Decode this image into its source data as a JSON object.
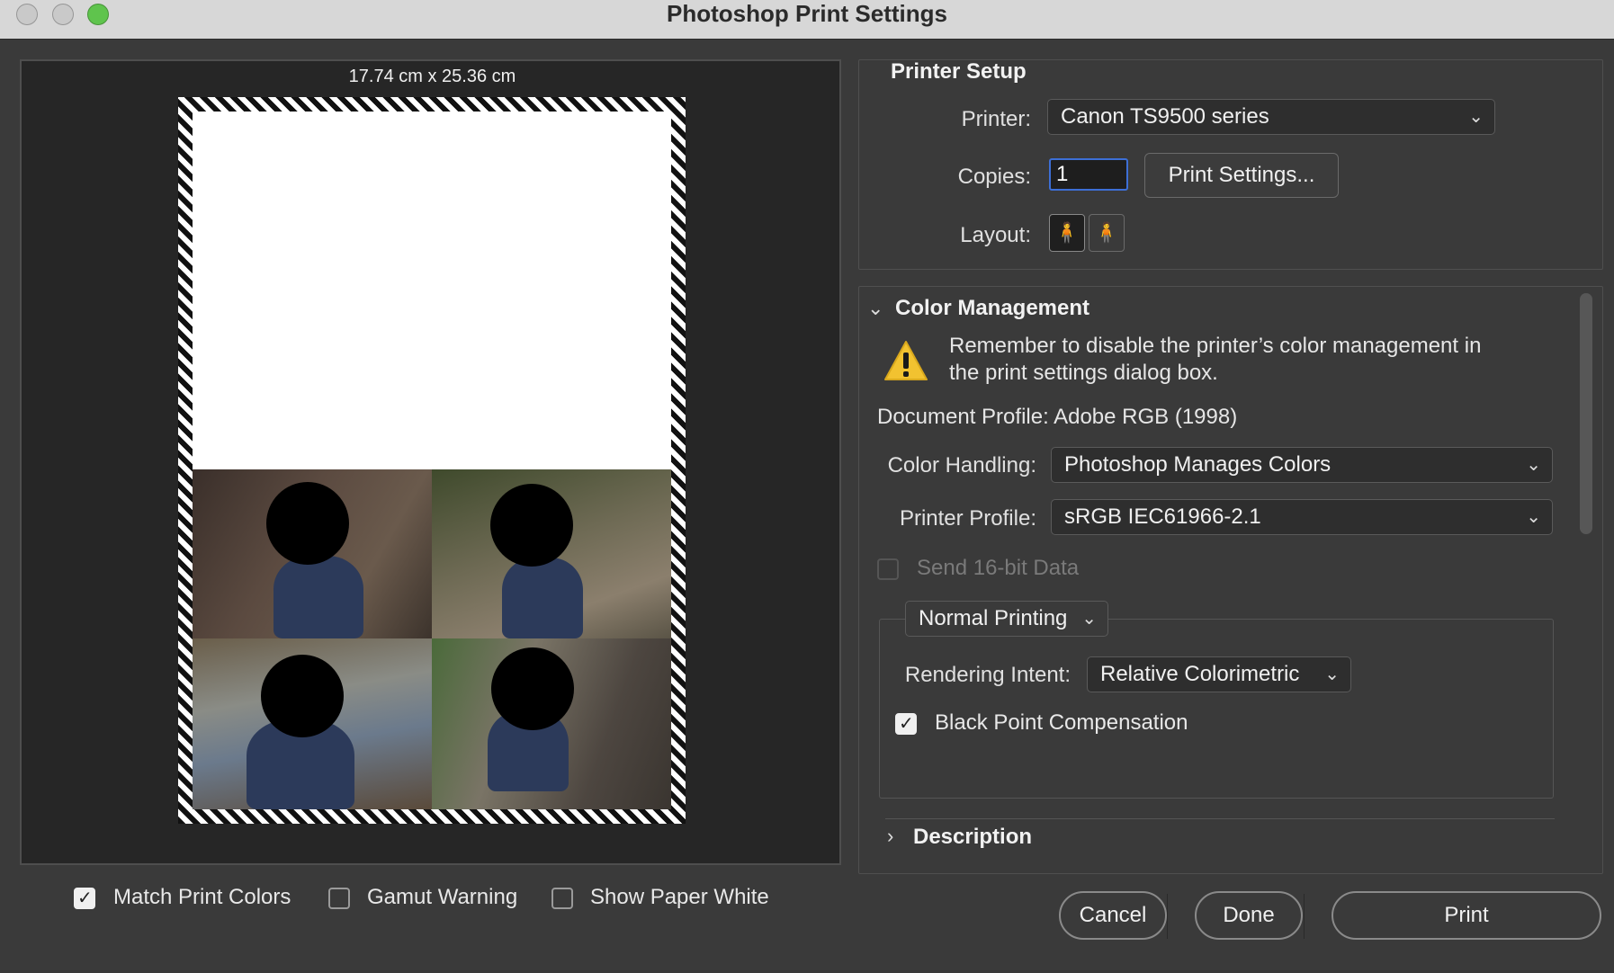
{
  "window": {
    "title": "Photoshop Print Settings"
  },
  "preview": {
    "paper_size": "17.74 cm x 25.36 cm",
    "options": [
      {
        "label": "Match Print Colors",
        "checked": true
      },
      {
        "label": "Gamut Warning",
        "checked": false
      },
      {
        "label": "Show Paper White",
        "checked": false
      }
    ]
  },
  "printer_setup": {
    "title": "Printer Setup",
    "printer_label": "Printer:",
    "printer_value": "Canon TS9500 series",
    "copies_label": "Copies:",
    "copies_value": "1",
    "print_settings_button": "Print Settings...",
    "layout_label": "Layout:",
    "layout_icons": [
      "portrait-layout-icon",
      "landscape-layout-icon"
    ]
  },
  "color_management": {
    "title": "Color Management",
    "warning": "Remember to disable the printer’s color management in the print settings dialog box.",
    "document_profile": "Document Profile: Adobe RGB (1998)",
    "color_handling_label": "Color Handling:",
    "color_handling_value": "Photoshop Manages Colors",
    "printer_profile_label": "Printer Profile:",
    "printer_profile_value": "sRGB IEC61966-2.1",
    "send_16bit_label": "Send 16-bit Data",
    "send_16bit_checked": false,
    "print_mode": "Normal Printing",
    "rendering_intent_label": "Rendering Intent:",
    "rendering_intent_value": "Relative Colorimetric",
    "black_point_label": "Black Point Compensation",
    "black_point_checked": true
  },
  "description": {
    "title": "Description"
  },
  "buttons": {
    "cancel": "Cancel",
    "done": "Done",
    "print": "Print"
  },
  "colors": {
    "accent": "#3d6fd6",
    "warning": "#f2c230",
    "zoom_button": "#5fc44d"
  }
}
